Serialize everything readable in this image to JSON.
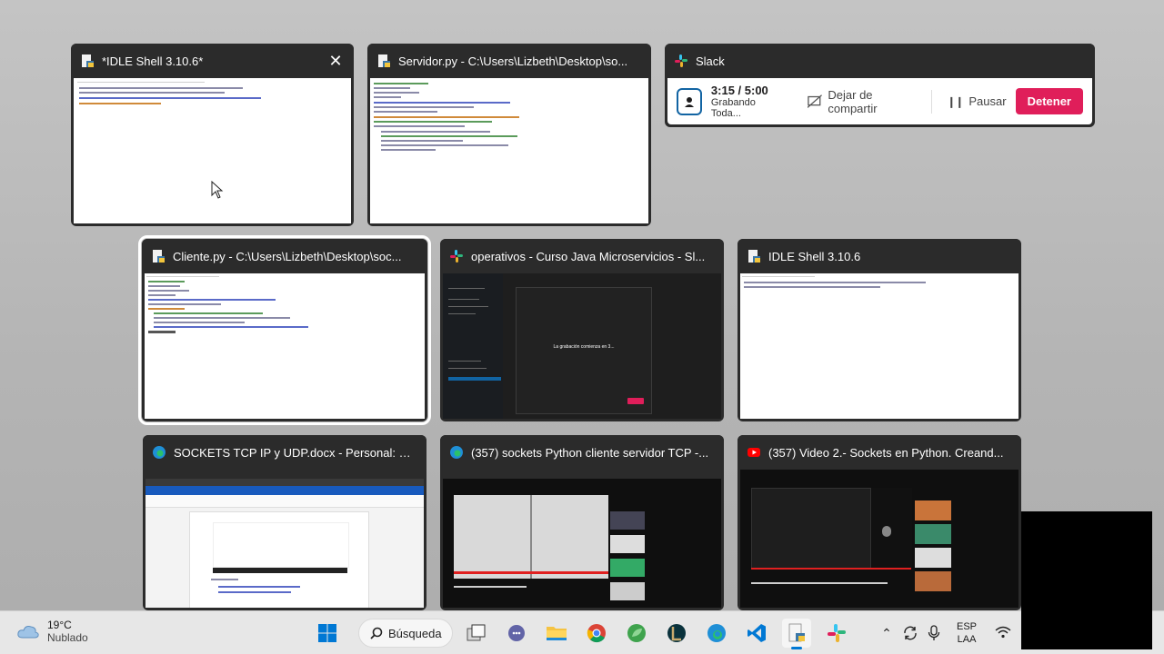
{
  "windows": [
    {
      "title": "*IDLE Shell 3.10.6*",
      "app_icon": "python-idle-icon",
      "selected": false,
      "has_close": true,
      "close_icon": "close-icon"
    },
    {
      "title": "Servidor.py - C:\\Users\\Lizbeth\\Desktop\\so...",
      "app_icon": "python-idle-icon",
      "selected": false
    },
    {
      "title": "Slack",
      "app_icon": "slack-icon",
      "selected": false
    },
    {
      "title": "Cliente.py - C:\\Users\\Lizbeth\\Desktop\\soc...",
      "app_icon": "python-idle-icon",
      "selected": true
    },
    {
      "title": "operativos - Curso Java Microservicios - Sl...",
      "app_icon": "slack-icon",
      "selected": false
    },
    {
      "title": "IDLE Shell 3.10.6",
      "app_icon": "python-idle-icon",
      "selected": false
    },
    {
      "title": "SOCKETS TCP IP y UDP.docx - Personal: Mi...",
      "app_icon": "edge-icon",
      "selected": false
    },
    {
      "title": "(357) sockets Python cliente servidor TCP -...",
      "app_icon": "edge-icon",
      "selected": false
    },
    {
      "title": "(357) Video 2.- Sockets en Python. Creand...",
      "app_icon": "youtube-icon",
      "selected": false
    }
  ],
  "slack_recording": {
    "time": "3:15 / 5:00",
    "subtitle": "Grabando Toda...",
    "stop_share_label": "Dejar de compartir",
    "pause_label": "Pausar",
    "stop_label": "Detener",
    "stop_color": "#e01e5a"
  },
  "operativos_modal_text": "La grabación comienza en 3...",
  "taskbar": {
    "weather_temp": "19°C",
    "weather_condition": "Nublado",
    "search_label": "Búsqueda",
    "language": "ESP",
    "language_sub": "LAA",
    "pinned": [
      "windows-start-icon",
      "search-icon",
      "task-view-icon",
      "teams-chat-icon",
      "file-explorer-icon",
      "chrome-icon",
      "leaf-app-icon",
      "league-icon",
      "edge-icon",
      "vscode-icon",
      "python-idle-icon",
      "slack-icon"
    ],
    "tray": [
      "chevron-up-icon",
      "sync-icon",
      "microphone-icon",
      "wifi-icon"
    ]
  },
  "colors": {
    "accent": "#0078d4",
    "slack_red": "#e01e5a",
    "window_title_bg": "#2b2b2b"
  }
}
